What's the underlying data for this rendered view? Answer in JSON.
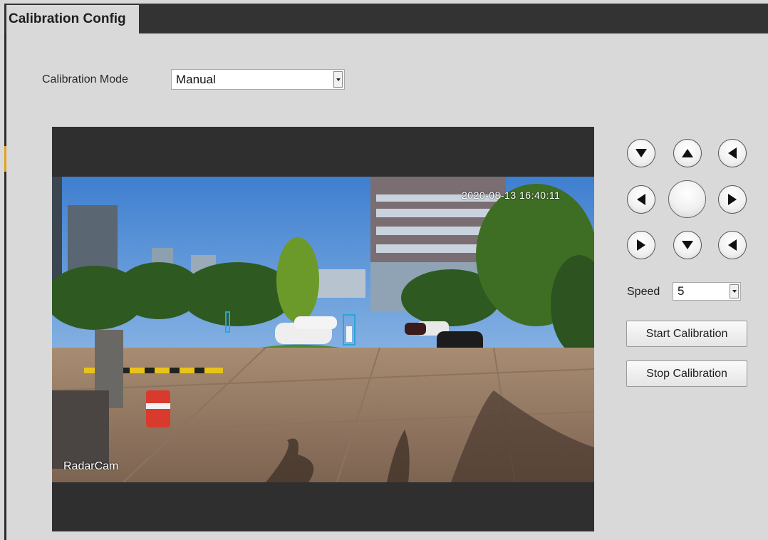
{
  "header": {
    "tab_label": "Calibration Config"
  },
  "form": {
    "mode_label": "Calibration Mode",
    "mode_value": "Manual",
    "speed_label": "Speed",
    "speed_value": "5"
  },
  "video": {
    "osd_timestamp": "2020-08-13 16:40:11",
    "osd_camera_name": "RadarCam"
  },
  "ptz": {
    "buttons": [
      "up-left",
      "up",
      "up-right",
      "left",
      "center",
      "right",
      "down-left",
      "down",
      "down-right"
    ]
  },
  "actions": {
    "start_label": "Start Calibration",
    "stop_label": "Stop Calibration"
  },
  "colors": {
    "header_bar": "#333333",
    "page_background": "#d9d9d9",
    "accent": "#e4a11b",
    "video_letterbox": "#2f2f2f"
  }
}
